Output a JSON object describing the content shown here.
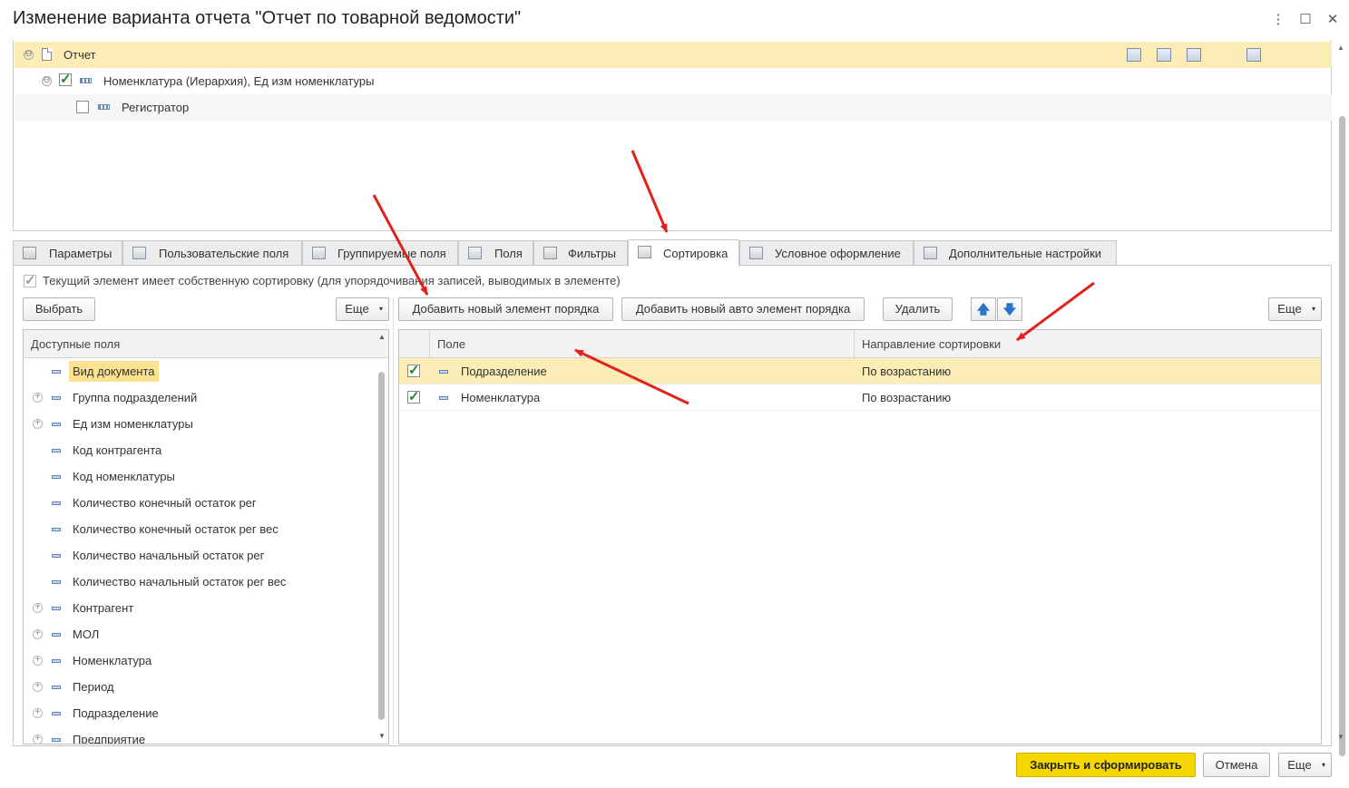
{
  "window": {
    "title": "Изменение варианта отчета \"Отчет по товарной ведомости\"",
    "menu_glyph": "⋮",
    "maximize_glyph": "☐",
    "close_glyph": "✕"
  },
  "structure": {
    "items": [
      {
        "label": "Отчет",
        "collapse": "⊖"
      },
      {
        "label": "Номенклатура (Иерархия), Ед изм номенклатуры",
        "collapse": "⊖",
        "checked": true
      },
      {
        "label": "Регистратор",
        "checked": false
      }
    ]
  },
  "tabs": [
    {
      "label": "Параметры",
      "icon": "parameters-icon"
    },
    {
      "label": "Пользовательские поля",
      "icon": "formula-icon"
    },
    {
      "label": "Группируемые поля",
      "icon": "grouped-fields-icon"
    },
    {
      "label": "Поля",
      "icon": "fields-icon"
    },
    {
      "label": "Фильтры",
      "icon": "filter-icon"
    },
    {
      "label": "Сортировка",
      "icon": "sort-icon",
      "active": true
    },
    {
      "label": "Условное оформление",
      "icon": "conditional-format-icon"
    },
    {
      "label": "Дополнительные настройки",
      "icon": "settings-icon"
    }
  ],
  "sorting": {
    "own_sort_label": "Текущий элемент имеет собственную сортировку (для  упорядочивания записей, выводимых в элементе)",
    "own_sort_checked": true,
    "left_toolbar": {
      "select": "Выбрать",
      "more": "Еще"
    },
    "right_toolbar": {
      "add": "Добавить новый элемент порядка",
      "add_auto": "Добавить новый авто элемент порядка",
      "delete": "Удалить",
      "up": "🡅",
      "down": "🡇",
      "more": "Еще"
    },
    "dropdown_glyph": "▾",
    "available_fields": {
      "header": "Доступные поля",
      "items": [
        {
          "label": "Вид документа",
          "expandable": false,
          "selected": true
        },
        {
          "label": "Группа подразделений",
          "expandable": true
        },
        {
          "label": "Ед изм номенклатуры",
          "expandable": true
        },
        {
          "label": "Код контрагента",
          "expandable": false
        },
        {
          "label": "Код номенклатуры",
          "expandable": false
        },
        {
          "label": "Количество конечный остаток рег",
          "expandable": false
        },
        {
          "label": "Количество конечный остаток рег вес",
          "expandable": false
        },
        {
          "label": "Количество начальный остаток рег",
          "expandable": false
        },
        {
          "label": "Количество начальный остаток рег вес",
          "expandable": false
        },
        {
          "label": "Контрагент",
          "expandable": true
        },
        {
          "label": "МОЛ",
          "expandable": true
        },
        {
          "label": "Номенклатура",
          "expandable": true
        },
        {
          "label": "Период",
          "expandable": true
        },
        {
          "label": "Подразделение",
          "expandable": true
        },
        {
          "label": "Предприятие",
          "expandable": true
        }
      ],
      "expand_glyph": "+"
    },
    "order_table": {
      "columns": [
        "Поле",
        "Направление сортировки"
      ],
      "rows": [
        {
          "field": "Подразделение",
          "direction": "По возрастанию",
          "checked": true,
          "selected": true
        },
        {
          "field": "Номенклатура",
          "direction": "По возрастанию",
          "checked": true,
          "selected": false
        }
      ]
    }
  },
  "footer": {
    "close_and_generate": "Закрыть и сформировать",
    "cancel": "Отмена",
    "more": "Еще"
  },
  "colors": {
    "accent_yellow": "#f4d800",
    "selection": "#fbedb5",
    "annotation_arrow": "#e3211b",
    "check_green": "#1a8a2a"
  }
}
